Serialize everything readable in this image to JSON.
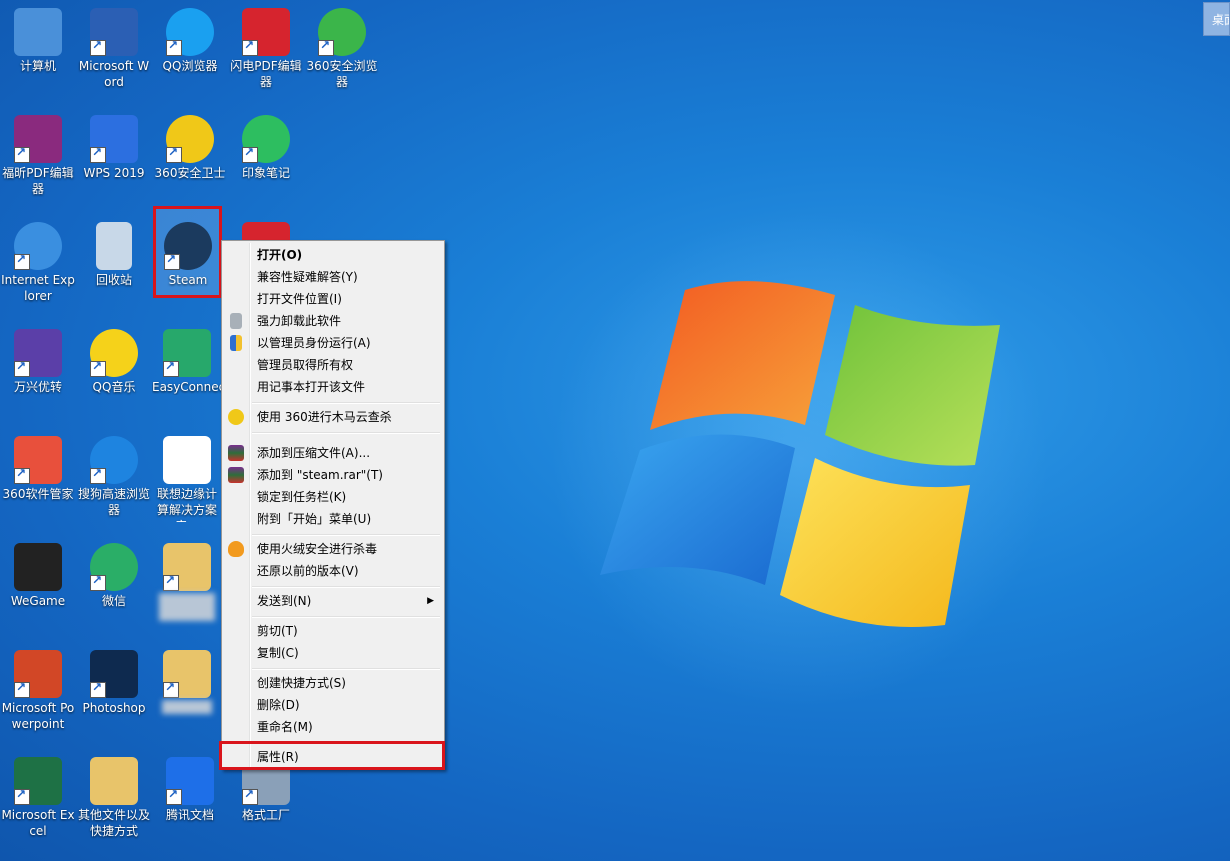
{
  "desktop": {
    "corner_button": "桌面",
    "icons": [
      {
        "label": "计算机",
        "color": "#4a90d9"
      },
      {
        "label": "Microsoft Word",
        "color": "#2b5fb4"
      },
      {
        "label": "QQ浏览器",
        "color": "#1aa0f0"
      },
      {
        "label": "闪电PDF编辑器",
        "color": "#d6242e"
      },
      {
        "label": "360安全浏览器",
        "color": "#3bb54a"
      },
      {
        "label": "福昕PDF编辑器",
        "color": "#8a2a7e"
      },
      {
        "label": "WPS 2019",
        "color": "#2c6fe0"
      },
      {
        "label": "360安全卫士",
        "color": "#f0c818"
      },
      {
        "label": "印象笔记",
        "color": "#2dbe60"
      },
      {
        "label": "Internet Explorer",
        "color": "#3a8fe0"
      },
      {
        "label": "回收站",
        "color": "#c8d8e8"
      },
      {
        "label": "Steam",
        "color": "#1b3a5e"
      },
      {
        "label": "万兴优转",
        "color": "#5b3fa8"
      },
      {
        "label": "QQ音乐",
        "color": "#f5d21a"
      },
      {
        "label": "EasyConnect",
        "color": "#27a86b"
      },
      {
        "label": "360软件管家",
        "color": "#e8503c"
      },
      {
        "label": "搜狗高速浏览器",
        "color": "#1e84e0"
      },
      {
        "label": "联想边缘计算解决方案产...",
        "color": "#ffffff"
      },
      {
        "label": "WeGame",
        "color": "#222222"
      },
      {
        "label": "微信",
        "color": "#2aae67"
      },
      {
        "label": "Microsoft Powerpoint",
        "color": "#d24726"
      },
      {
        "label": "Photoshop",
        "color": "#0e2a4f"
      },
      {
        "label": "Microsoft Excel",
        "color": "#1e7145"
      },
      {
        "label": "其他文件以及快捷方式",
        "color": "#e8c46a"
      },
      {
        "label": "腾讯文档",
        "color": "#1e6fe8"
      },
      {
        "label": "格式工厂",
        "color": "#8aa0b8"
      }
    ]
  },
  "context_menu": {
    "items": [
      {
        "label": "打开(O)",
        "icon": "none"
      },
      {
        "label": "兼容性疑难解答(Y)",
        "icon": "none"
      },
      {
        "label": "打开文件位置(I)",
        "icon": "none"
      },
      {
        "label": "强力卸载此软件",
        "icon": "trash-icon"
      },
      {
        "label": "以管理员身份运行(A)",
        "icon": "shield-icon"
      },
      {
        "label": "管理员取得所有权",
        "icon": "none"
      },
      {
        "label": "用记事本打开该文件",
        "icon": "none"
      },
      {
        "label": "使用 360进行木马云查杀",
        "icon": "360-icon"
      },
      {
        "label": "添加到压缩文件(A)...",
        "icon": "winrar-icon"
      },
      {
        "label": "添加到 \"steam.rar\"(T)",
        "icon": "winrar-icon"
      },
      {
        "label": "锁定到任务栏(K)",
        "icon": "none"
      },
      {
        "label": "附到「开始」菜单(U)",
        "icon": "none"
      },
      {
        "label": "使用火绒安全进行杀毒",
        "icon": "huorong-icon"
      },
      {
        "label": "还原以前的版本(V)",
        "icon": "none"
      },
      {
        "label": "发送到(N)",
        "icon": "none"
      },
      {
        "label": "剪切(T)",
        "icon": "none"
      },
      {
        "label": "复制(C)",
        "icon": "none"
      },
      {
        "label": "创建快捷方式(S)",
        "icon": "none"
      },
      {
        "label": "删除(D)",
        "icon": "none"
      },
      {
        "label": "重命名(M)",
        "icon": "none"
      },
      {
        "label": "属性(R)",
        "icon": "none"
      }
    ]
  }
}
